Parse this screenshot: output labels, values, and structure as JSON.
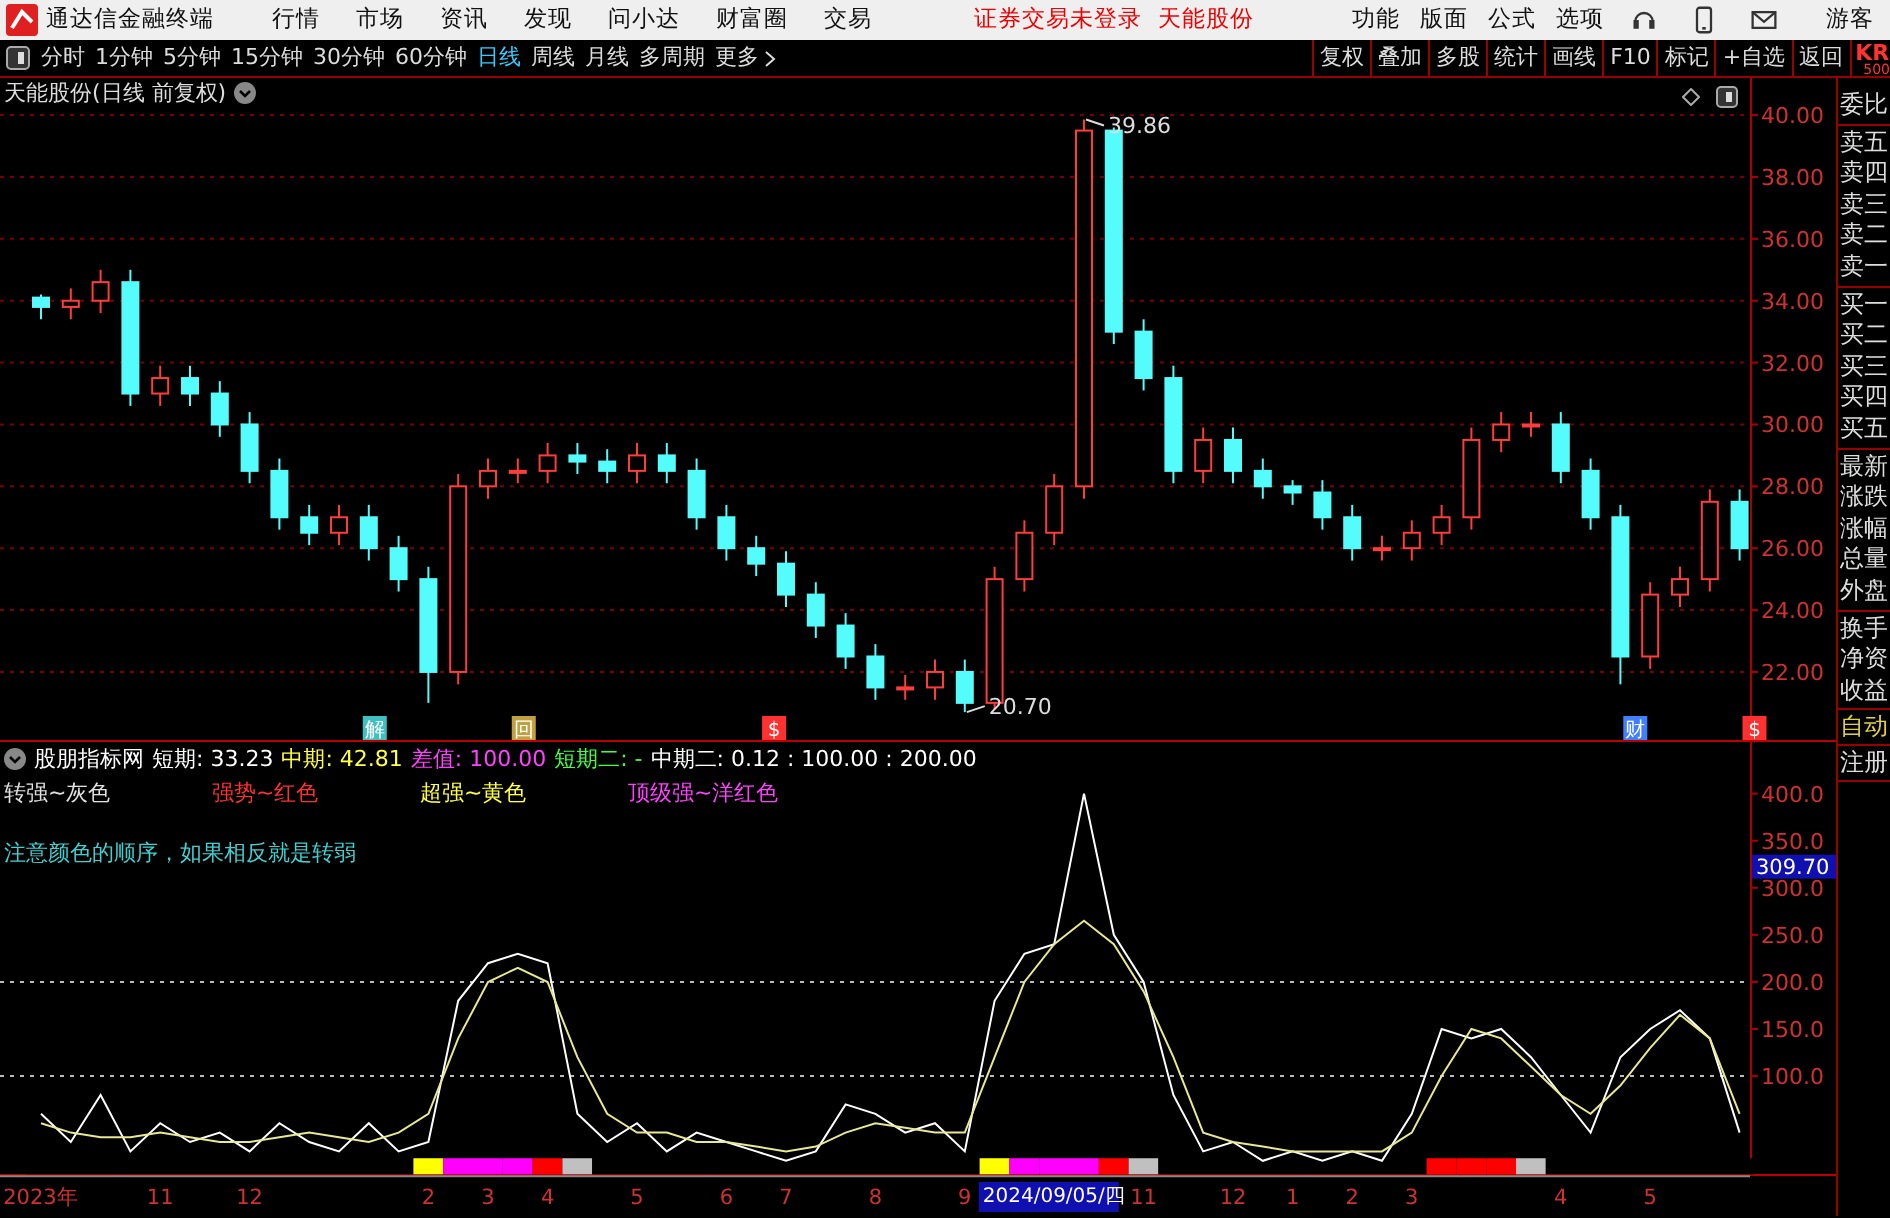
{
  "menu_bar": {
    "app_title": "通达信金融终端",
    "menu": [
      "行情",
      "市场",
      "资讯",
      "发现",
      "问小达",
      "财富圈",
      "交易"
    ],
    "login_status": "证券交易未登录",
    "stock_name": "天能股份",
    "tools": [
      "功能",
      "版面",
      "公式",
      "选项"
    ],
    "user": "游客"
  },
  "period_bar": {
    "periods": [
      {
        "label": "分时",
        "selected": false
      },
      {
        "label": "1分钟",
        "selected": false
      },
      {
        "label": "5分钟",
        "selected": false
      },
      {
        "label": "15分钟",
        "selected": false
      },
      {
        "label": "30分钟",
        "selected": false
      },
      {
        "label": "60分钟",
        "selected": false
      },
      {
        "label": "日线",
        "selected": true
      },
      {
        "label": "周线",
        "selected": false
      },
      {
        "label": "月线",
        "selected": false
      },
      {
        "label": "多周期",
        "selected": false
      }
    ],
    "more": "更多",
    "actions": [
      "复权",
      "叠加",
      "多股",
      "统计",
      "画线",
      "F10",
      "标记",
      "+自选",
      "返回"
    ],
    "code": "KR",
    "code_sub": "500"
  },
  "price_panel": {
    "title": "天能股份(日线 前复权)",
    "chart_data": {
      "type": "candlestick",
      "grid": true,
      "categories": [
        null,
        null,
        null,
        null,
        null,
        null,
        null,
        null,
        null,
        null,
        null,
        null,
        null,
        null,
        null,
        null,
        null,
        null,
        null,
        null,
        null,
        null,
        null,
        null,
        null,
        null,
        null,
        null,
        null,
        null,
        null,
        null,
        null,
        null,
        null,
        null,
        null,
        null,
        null,
        null,
        null,
        null,
        null,
        null,
        null,
        null,
        null,
        null,
        null,
        null,
        null,
        null,
        null,
        null,
        null,
        null,
        null,
        null
      ],
      "ylim": [
        19.8,
        41.2
      ],
      "yticks": [
        {
          "value": 40,
          "label": "40.00"
        },
        {
          "value": 38,
          "label": "38.00"
        },
        {
          "value": 36,
          "label": "36.00"
        },
        {
          "value": 34,
          "label": "34.00"
        },
        {
          "value": 32,
          "label": "32.00"
        },
        {
          "value": 30,
          "label": "30.00"
        },
        {
          "value": 28,
          "label": "28.00"
        },
        {
          "value": 26,
          "label": "26.00"
        },
        {
          "value": 24,
          "label": "24.00"
        },
        {
          "value": 22,
          "label": "22.00"
        }
      ],
      "ohlc": [
        [
          34.1,
          34.2,
          33.4,
          33.8
        ],
        [
          33.8,
          34.4,
          33.4,
          34
        ],
        [
          34,
          35,
          33.6,
          34.6
        ],
        [
          34.6,
          35,
          30.6,
          31
        ],
        [
          31,
          31.9,
          30.6,
          31.5
        ],
        [
          31.5,
          31.9,
          30.6,
          31
        ],
        [
          31,
          31.4,
          29.6,
          30
        ],
        [
          30,
          30.4,
          28.1,
          28.5
        ],
        [
          28.5,
          28.9,
          26.6,
          27
        ],
        [
          27,
          27.4,
          26.1,
          26.5
        ],
        [
          26.5,
          27.4,
          26.1,
          27
        ],
        [
          27,
          27.4,
          25.6,
          26
        ],
        [
          26,
          26.4,
          24.6,
          25
        ],
        [
          25,
          25.4,
          21,
          22
        ],
        [
          22,
          28.4,
          21.6,
          28
        ],
        [
          28,
          28.9,
          27.6,
          28.5
        ],
        [
          28.5,
          28.9,
          28.1,
          28.5
        ],
        [
          28.5,
          29.4,
          28.1,
          29
        ],
        [
          29,
          29.4,
          28.4,
          28.8
        ],
        [
          28.8,
          29.2,
          28.1,
          28.5
        ],
        [
          28.5,
          29.4,
          28.1,
          29
        ],
        [
          29,
          29.4,
          28.1,
          28.5
        ],
        [
          28.5,
          28.9,
          26.6,
          27
        ],
        [
          27,
          27.4,
          25.6,
          26
        ],
        [
          26,
          26.4,
          25.1,
          25.5
        ],
        [
          25.5,
          25.9,
          24.1,
          24.5
        ],
        [
          24.5,
          24.9,
          23.1,
          23.5
        ],
        [
          23.5,
          23.9,
          22.1,
          22.5
        ],
        [
          22.5,
          22.9,
          21.1,
          21.5
        ],
        [
          21.5,
          21.9,
          21.1,
          21.5
        ],
        [
          21.5,
          22.4,
          21.1,
          22
        ],
        [
          22,
          22.4,
          20.7,
          21
        ],
        [
          21,
          25.4,
          20.8,
          25
        ],
        [
          25,
          26.9,
          24.6,
          26.5
        ],
        [
          26.5,
          28.4,
          26.1,
          28
        ],
        [
          28,
          39.86,
          27.6,
          39.5
        ],
        [
          39.5,
          39.6,
          32.6,
          33
        ],
        [
          33,
          33.4,
          31.1,
          31.5
        ],
        [
          31.5,
          31.9,
          28.1,
          28.5
        ],
        [
          28.5,
          29.9,
          28.1,
          29.5
        ],
        [
          29.5,
          29.9,
          28.1,
          28.5
        ],
        [
          28.5,
          28.9,
          27.6,
          28
        ],
        [
          28,
          28.2,
          27.4,
          27.8
        ],
        [
          27.8,
          28.2,
          26.6,
          27
        ],
        [
          27,
          27.4,
          25.6,
          26
        ],
        [
          26,
          26.4,
          25.6,
          26
        ],
        [
          26,
          26.9,
          25.6,
          26.5
        ],
        [
          26.5,
          27.4,
          26.1,
          27
        ],
        [
          27,
          29.9,
          26.6,
          29.5
        ],
        [
          29.5,
          30.4,
          29.1,
          30
        ],
        [
          30,
          30.4,
          29.6,
          30
        ],
        [
          30,
          30.4,
          28.1,
          28.5
        ],
        [
          28.5,
          28.9,
          26.6,
          27
        ],
        [
          27,
          27.4,
          21.6,
          22.5
        ],
        [
          22.5,
          24.9,
          22.1,
          24.5
        ],
        [
          24.5,
          25.4,
          24.1,
          25
        ],
        [
          25,
          27.9,
          24.6,
          27.5
        ],
        [
          27.5,
          27.9,
          25.6,
          26
        ]
      ],
      "annotations": [
        "39.86",
        "20.70"
      ]
    },
    "event_markers": [
      {
        "text": "解",
        "color": "#40c0c0"
      },
      {
        "text": "回",
        "color": "#c0a040"
      },
      {
        "text": "$",
        "color": "#ff3030"
      },
      {
        "text": "财",
        "color": "#4080ff"
      },
      {
        "text": "$",
        "color": "#ff3030"
      }
    ]
  },
  "indicator_panel": {
    "name": "股朋指标网",
    "readouts": [
      {
        "text": "短期: 33.23",
        "color": "#ffffff"
      },
      {
        "text": "中期: 42.81",
        "color": "#ffff40"
      },
      {
        "text": "差值: 100.00",
        "color": "#ff40ff"
      },
      {
        "text": "短期二: -",
        "color": "#40ff40"
      },
      {
        "text": "中期二: 0.12 : 100.00 : 200.00",
        "color": "#ffffff"
      }
    ],
    "legend": [
      {
        "text": "转强~灰色",
        "color": "#e0e0e0"
      },
      {
        "text": "强势~红色",
        "color": "#ff3030"
      },
      {
        "text": "超强~黄色",
        "color": "#ffff40"
      },
      {
        "text": "顶级强~洋红色",
        "color": "#ff40ff"
      }
    ],
    "note": "注意颜色的顺序，如果相反就是转弱",
    "chart_data": {
      "type": "line",
      "categories": [
        "2023年",
        null,
        null,
        null,
        "11",
        null,
        null,
        "12",
        null,
        null,
        null,
        null,
        null,
        "2",
        null,
        "3",
        null,
        "4",
        null,
        null,
        "5",
        null,
        null,
        "6",
        null,
        "7",
        null,
        null,
        "8",
        null,
        null,
        "9",
        null,
        null,
        null,
        null,
        null,
        "11",
        null,
        null,
        "12",
        null,
        "1",
        null,
        "2",
        null,
        "3",
        null,
        null,
        null,
        null,
        "4",
        null,
        null,
        "5",
        null,
        null,
        null
      ],
      "ylim": [
        -4,
        457
      ],
      "yticks": [
        {
          "value": 100,
          "label": "100.0"
        },
        {
          "value": 150,
          "label": "150.0"
        },
        {
          "value": 200,
          "label": "200.0"
        },
        {
          "value": 250,
          "label": "250.0"
        },
        {
          "value": 300,
          "label": "300.0"
        },
        {
          "value": 350,
          "label": "350.0"
        },
        {
          "value": 400,
          "label": "400.0"
        }
      ],
      "series": [
        {
          "color": "#ffffff",
          "values": [
            60,
            30,
            80,
            20,
            50,
            30,
            40,
            20,
            50,
            30,
            20,
            50,
            20,
            30,
            180,
            220,
            230,
            220,
            60,
            30,
            50,
            20,
            40,
            30,
            20,
            10,
            20,
            70,
            60,
            40,
            50,
            20,
            180,
            230,
            240,
            400,
            250,
            200,
            80,
            20,
            30,
            10,
            20,
            10,
            20,
            10,
            60,
            150,
            140,
            150,
            120,
            80,
            40,
            120,
            150,
            170,
            140,
            40
          ]
        },
        {
          "color": "#e8e890",
          "values": [
            50,
            40,
            35,
            35,
            40,
            35,
            30,
            30,
            35,
            40,
            35,
            30,
            40,
            60,
            140,
            200,
            215,
            200,
            120,
            60,
            40,
            40,
            30,
            30,
            25,
            20,
            25,
            40,
            50,
            45,
            40,
            40,
            120,
            200,
            240,
            265,
            240,
            190,
            120,
            40,
            30,
            25,
            20,
            20,
            20,
            20,
            40,
            100,
            150,
            140,
            110,
            80,
            60,
            90,
            130,
            165,
            140,
            60
          ]
        }
      ],
      "annotations": [
        "309.70",
        "2024/09/05/四"
      ]
    },
    "strip": [
      {
        "color": "#000000"
      },
      {
        "color": "#000000"
      },
      {
        "color": "#000000"
      },
      {
        "color": "#000000"
      },
      {
        "color": "#000000"
      },
      {
        "color": "#000000"
      },
      {
        "color": "#000000"
      },
      {
        "color": "#000000"
      },
      {
        "color": "#000000"
      },
      {
        "color": "#000000"
      },
      {
        "color": "#000000"
      },
      {
        "color": "#000000"
      },
      {
        "color": "#000000"
      },
      {
        "color": "#ffff00"
      },
      {
        "color": "#ff00ff"
      },
      {
        "color": "#ff00ff"
      },
      {
        "color": "#ff00ff"
      },
      {
        "color": "#ff0000"
      },
      {
        "color": "#c0c0c0"
      },
      {
        "color": "#000000"
      },
      {
        "color": "#000000"
      },
      {
        "color": "#000000"
      },
      {
        "color": "#000000"
      },
      {
        "color": "#000000"
      },
      {
        "color": "#000000"
      },
      {
        "color": "#000000"
      },
      {
        "color": "#000000"
      },
      {
        "color": "#000000"
      },
      {
        "color": "#000000"
      },
      {
        "color": "#000000"
      },
      {
        "color": "#000000"
      },
      {
        "color": "#000000"
      },
      {
        "color": "#ffff00"
      },
      {
        "color": "#ff00ff"
      },
      {
        "color": "#ff00ff"
      },
      {
        "color": "#ff00ff"
      },
      {
        "color": "#ff0000"
      },
      {
        "color": "#c0c0c0"
      },
      {
        "color": "#000000"
      },
      {
        "color": "#000000"
      },
      {
        "color": "#000000"
      },
      {
        "color": "#000000"
      },
      {
        "color": "#000000"
      },
      {
        "color": "#000000"
      },
      {
        "color": "#000000"
      },
      {
        "color": "#000000"
      },
      {
        "color": "#000000"
      },
      {
        "color": "#ff0000"
      },
      {
        "color": "#ff0000"
      },
      {
        "color": "#ff0000"
      },
      {
        "color": "#c0c0c0"
      },
      {
        "color": "#000000"
      },
      {
        "color": "#000000"
      },
      {
        "color": "#000000"
      },
      {
        "color": "#000000"
      },
      {
        "color": "#000000"
      },
      {
        "color": "#000000"
      },
      {
        "color": "#000000"
      }
    ]
  },
  "quote_sidebar": {
    "groups": [
      [
        "委比"
      ],
      [
        "卖五",
        "卖四",
        "卖三",
        "卖二",
        "卖一"
      ],
      [
        "买一",
        "买二",
        "买三",
        "买四",
        "买五"
      ],
      [
        "最新",
        "涨跌",
        "涨幅",
        "总量",
        "外盘"
      ],
      [
        "换手",
        "净资",
        "收益"
      ]
    ],
    "buttons": [
      {
        "label": "自动",
        "selected": true
      },
      {
        "label": "注册",
        "selected": false
      }
    ]
  }
}
